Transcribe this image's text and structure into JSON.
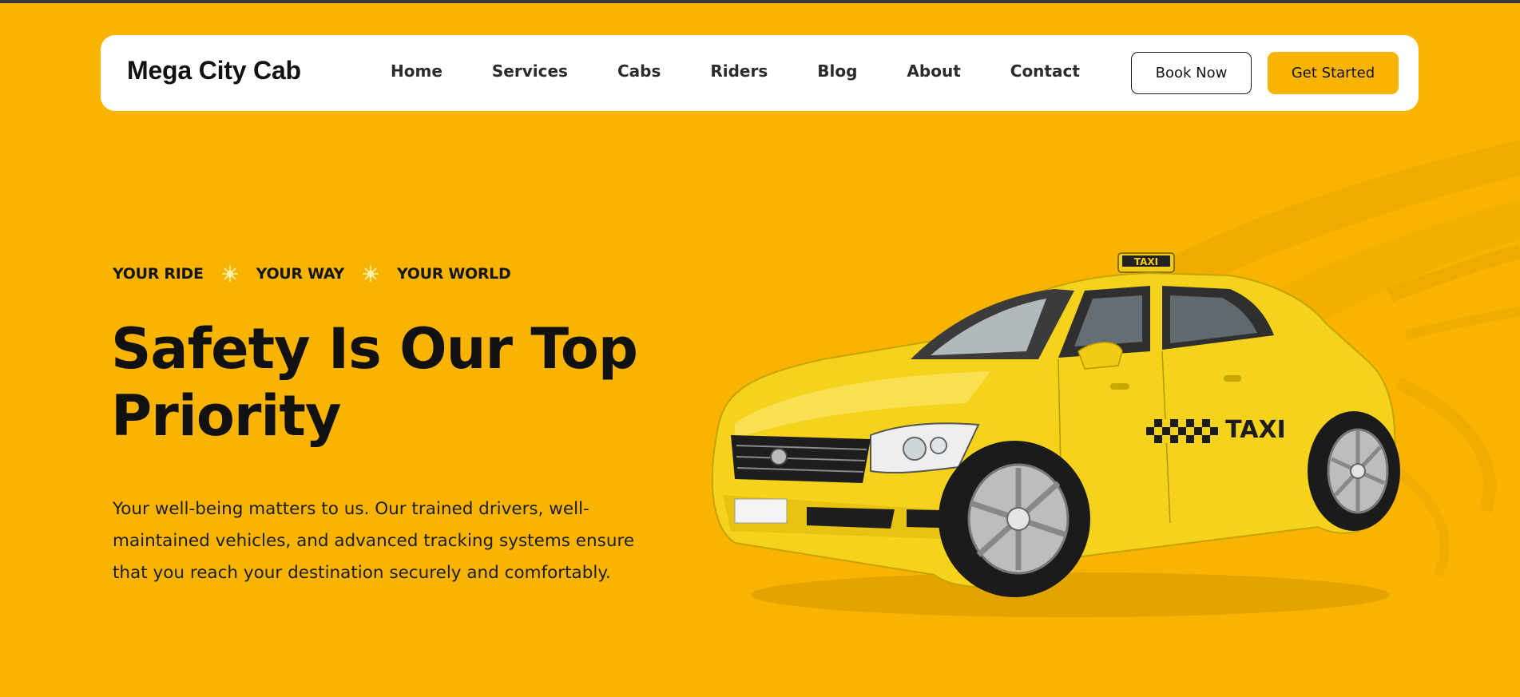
{
  "brand": {
    "name": "Mega City Cab"
  },
  "nav": {
    "links": [
      "Home",
      "Services",
      "Cabs",
      "Riders",
      "Blog",
      "About",
      "Contact"
    ],
    "book_label": "Book Now",
    "start_label": "Get Started"
  },
  "hero": {
    "tagline": [
      "YOUR RIDE",
      "YOUR WAY",
      "YOUR WORLD"
    ],
    "headline_line1": "Safety Is Our Top",
    "headline_line2": "Priority",
    "body": "Your well-being matters to us. Our trained drivers, well-maintained vehicles, and advanced tracking systems ensure that you reach your destination securely and comfortably.",
    "car_sign": "TAXI",
    "car_roof_sign": "TAXI"
  },
  "colors": {
    "accent": "#F8B400",
    "text": "#111111",
    "card": "#ffffff",
    "car_body": "#F5D21C"
  },
  "icons": {
    "tagline_separator": "sparkle-icon"
  }
}
